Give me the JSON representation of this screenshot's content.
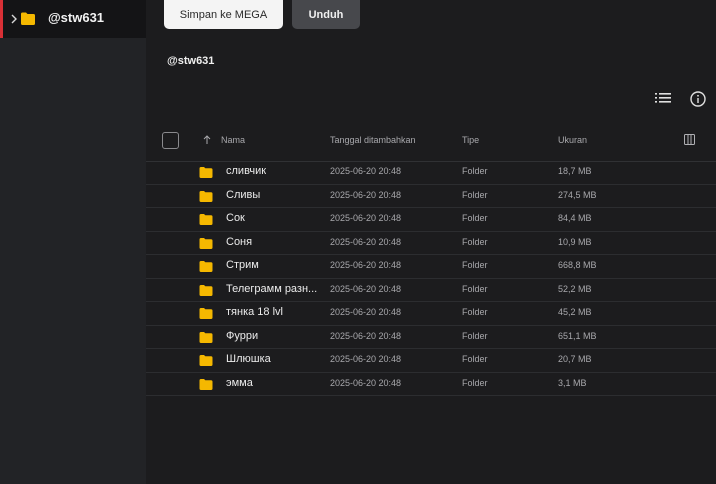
{
  "sidebar": {
    "items": [
      {
        "label": "@stw631",
        "icon": "folder-icon",
        "expanded": false,
        "selected": true
      }
    ],
    "accent_color": "#d93036"
  },
  "toolbar": {
    "save_label": "Simpan ke MEGA",
    "download_label": "Unduh"
  },
  "main": {
    "title": "@stw631"
  },
  "table": {
    "headers": {
      "name": "Nama",
      "date": "Tanggal ditambahkan",
      "type": "Tipe",
      "size": "Ukuran"
    },
    "rows": [
      {
        "name": "сливчик",
        "date": "2025-06-20 20:48",
        "type": "Folder",
        "size": "18,7 MB"
      },
      {
        "name": "Сливы",
        "date": "2025-06-20 20:48",
        "type": "Folder",
        "size": "274,5 MB"
      },
      {
        "name": "Сок",
        "date": "2025-06-20 20:48",
        "type": "Folder",
        "size": "84,4 MB"
      },
      {
        "name": "Соня",
        "date": "2025-06-20 20:48",
        "type": "Folder",
        "size": "10,9 MB"
      },
      {
        "name": "Стрим",
        "date": "2025-06-20 20:48",
        "type": "Folder",
        "size": "668,8 MB"
      },
      {
        "name": "Телеграмм разн...",
        "date": "2025-06-20 20:48",
        "type": "Folder",
        "size": "52,2 MB"
      },
      {
        "name": "тянка 18 lvl",
        "date": "2025-06-20 20:48",
        "type": "Folder",
        "size": "45,2 MB"
      },
      {
        "name": "Фурри",
        "date": "2025-06-20 20:48",
        "type": "Folder",
        "size": "651,1 MB"
      },
      {
        "name": "Шлюшка",
        "date": "2025-06-20 20:48",
        "type": "Folder",
        "size": "20,7 MB"
      },
      {
        "name": "эмма",
        "date": "2025-06-20 20:48",
        "type": "Folder",
        "size": "3,1 MB"
      }
    ]
  },
  "colors": {
    "folder": "#f5b800",
    "background": "#1c1c1e",
    "sidebar": "#222326"
  }
}
